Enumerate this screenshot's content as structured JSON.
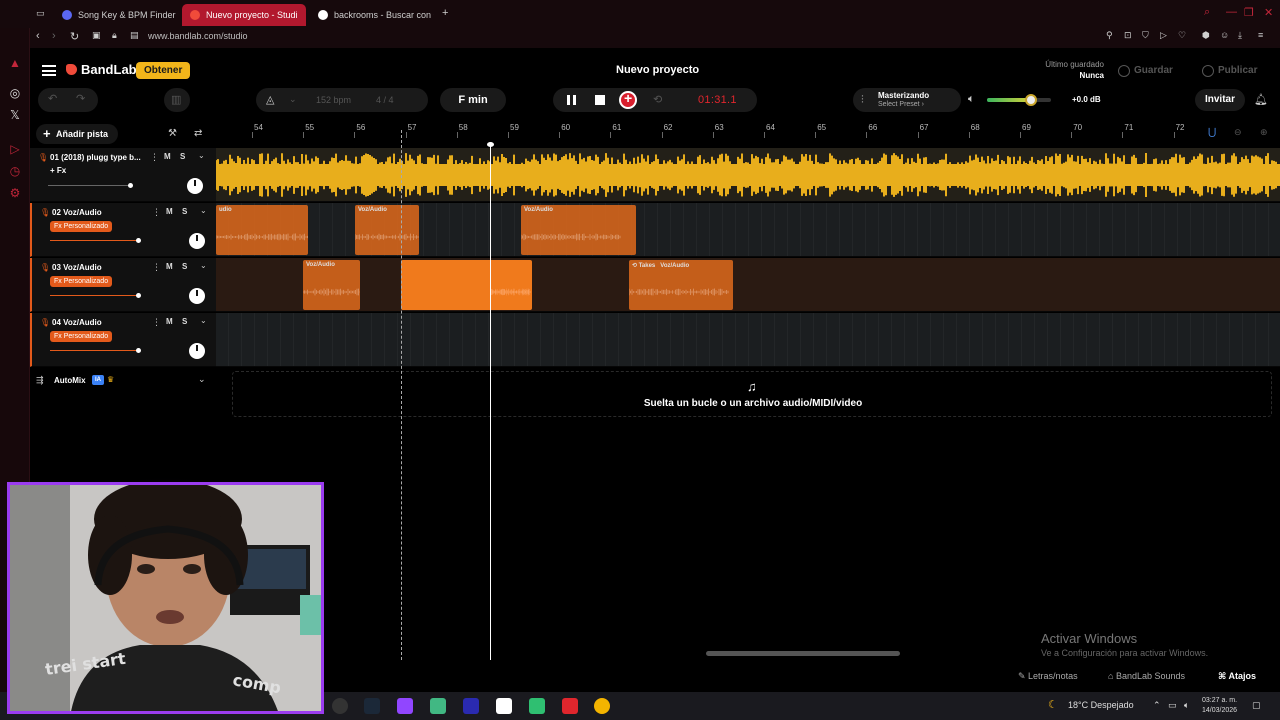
{
  "browser": {
    "tabs": [
      {
        "label": "Song Key & BPM Finder | T",
        "icon_color": "#5a67f2"
      },
      {
        "label": "Nuevo proyecto - Studi",
        "icon_color": "#f04b3a"
      },
      {
        "label": "backrooms - Buscar con G",
        "icon_color": "#ffffff"
      }
    ],
    "url": "www.bandlab.com/studio"
  },
  "app": {
    "logo": "BandLab",
    "obtener": "Obtener",
    "project_title": "Nuevo proyecto",
    "saved_label": "Último guardado",
    "saved_value": "Nunca",
    "guardar": "Guardar",
    "publicar": "Publicar"
  },
  "transport": {
    "bpm": "152 bpm",
    "time_sig": "4 / 4",
    "key": "F min",
    "time": "01:31.1",
    "master_title": "Masterizando",
    "master_sub": "Select Preset",
    "volume_db": "+0.0 dB",
    "volume_level": 0.68,
    "invite": "Invitar"
  },
  "tracks_panel": {
    "add_track": "Añadir pista",
    "automix_label": "AutoMix",
    "automix_badge": "IA"
  },
  "ruler": [
    "54",
    "55",
    "56",
    "57",
    "58",
    "59",
    "60",
    "61",
    "62",
    "63",
    "64",
    "65",
    "66",
    "67",
    "68",
    "69",
    "70",
    "71",
    "72"
  ],
  "tracks": [
    {
      "name": "01 (2018) plugg type b...",
      "fx": "+ Fx",
      "fx_custom": false,
      "m": "M",
      "s": "S",
      "volume": 0.7
    },
    {
      "name": "02 Voz/Audio",
      "fx": "Fx Personalizado",
      "fx_custom": true,
      "m": "M",
      "s": "S",
      "volume": 0.75
    },
    {
      "name": "03 Voz/Audio",
      "fx": "Fx Personalizado",
      "fx_custom": true,
      "m": "M",
      "s": "S",
      "volume": 0.75
    },
    {
      "name": "04 Voz/Audio",
      "fx": "Fx Personalizado",
      "fx_custom": true,
      "m": "M",
      "s": "S",
      "volume": 0.75
    }
  ],
  "clips": {
    "lane2": [
      "udio",
      "Voz/Audio",
      "Voz/Audio"
    ],
    "lane3": [
      "Voz/Audio",
      "Takes",
      "Voz/Audio"
    ]
  },
  "dropzone": {
    "text": "Suelta un bucle o un archivo audio/MIDI/video"
  },
  "watermark": {
    "title": "Activar Windows",
    "sub": "Ve a Configuración para activar Windows."
  },
  "bottom": {
    "lyrics": "Letras/notas",
    "sounds": "BandLab Sounds",
    "shortcuts": "Atajos"
  },
  "taskbar": {
    "weather": "18°C  Despejado",
    "time": "03:27 a. m.",
    "date": "14/03/2026"
  },
  "colors": {
    "accent": "#e35a1b",
    "brand": "#f04b3a",
    "obtener": "#f2b51a",
    "record": "#e0262d",
    "waveform": "#e8ae1c"
  }
}
